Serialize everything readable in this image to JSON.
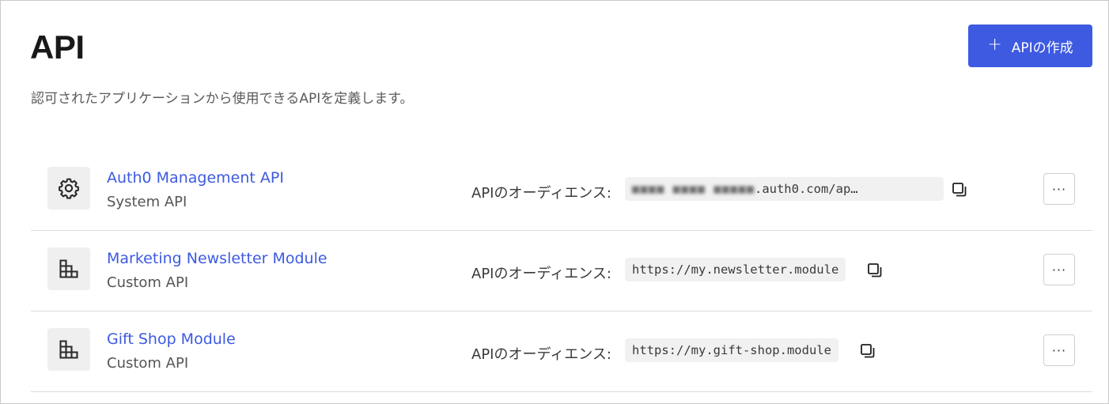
{
  "header": {
    "title": "API",
    "create_button_label": "APIの作成",
    "create_button_icon": "plus-icon",
    "description": "認可されたアプリケーションから使用できるAPIを定義します。"
  },
  "colors": {
    "accent": "#3d5ae1",
    "icon_bg": "#efefef"
  },
  "apis": [
    {
      "name": "Auth0 Management API",
      "type": "System API",
      "icon": "gear-icon",
      "audience_label": "APIのオーディエンス:",
      "audience_masked": "■■■■ ■■■■ ■■■■■",
      "audience_visible": ".auth0.com/ap…",
      "more_label": "···"
    },
    {
      "name": "Marketing Newsletter Module",
      "type": "Custom API",
      "icon": "building-icon",
      "audience_label": "APIのオーディエンス:",
      "audience": "https://my.newsletter.module",
      "more_label": "···"
    },
    {
      "name": "Gift Shop Module",
      "type": "Custom API",
      "icon": "building-icon",
      "audience_label": "APIのオーディエンス:",
      "audience": "https://my.gift-shop.module",
      "more_label": "···"
    }
  ]
}
